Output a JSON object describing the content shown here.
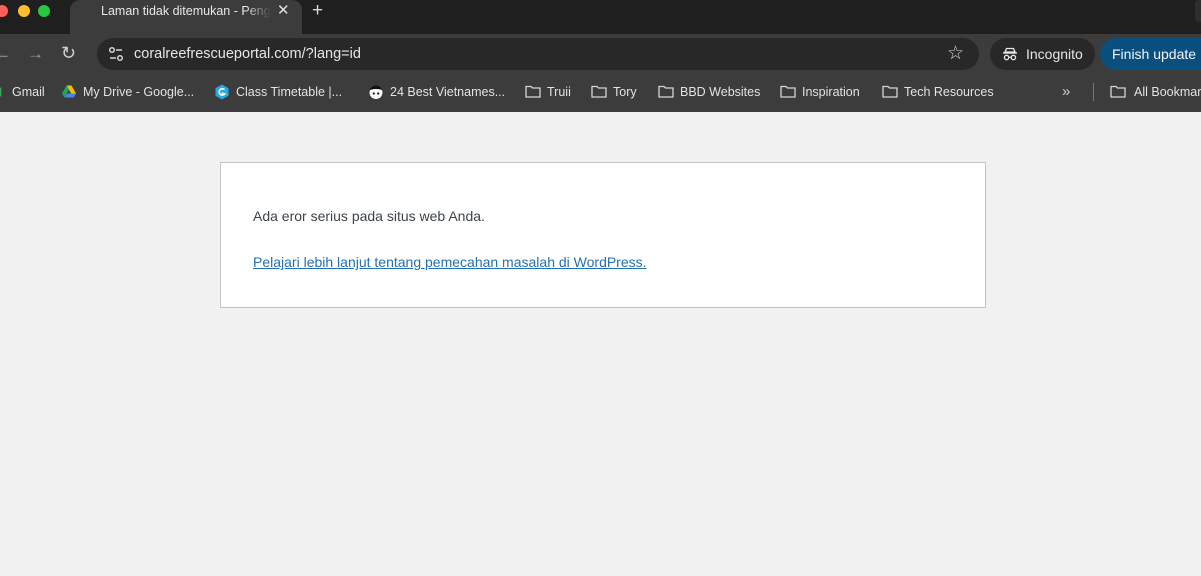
{
  "browser": {
    "tab": {
      "title": "Laman tidak ditemukan - Pengelola Situs"
    },
    "new_tab_symbol": "+",
    "tab_close_symbol": "✕",
    "address_bar": {
      "url": "coralreefrescueportal.com/?lang=id"
    },
    "incognito_label": "Incognito",
    "finish_update_label": "Finish update",
    "icons": {
      "back": "arrow-left-icon",
      "forward": "arrow-right-icon",
      "reload": "reload-icon",
      "site_info": "tune-icon",
      "bookmark_star": "star-icon",
      "incognito": "incognito-icon"
    }
  },
  "bookmarks": {
    "items": [
      {
        "label": "Gmail",
        "icon": "gmail-icon"
      },
      {
        "label": "My Drive - Google...",
        "icon": "google-drive-icon"
      },
      {
        "label": "Class Timetable |...",
        "icon": "hexagon-logo-icon"
      },
      {
        "label": "24 Best Vietnames...",
        "icon": "avatar-face-icon"
      },
      {
        "label": "Truii",
        "icon": "folder-icon"
      },
      {
        "label": "Tory",
        "icon": "folder-icon"
      },
      {
        "label": "BBD Websites",
        "icon": "folder-icon"
      },
      {
        "label": "Inspiration",
        "icon": "folder-icon"
      },
      {
        "label": "Tech Resources",
        "icon": "folder-icon"
      }
    ],
    "overflow_symbol": "»",
    "all_bookmarks_label": "All Bookmarks"
  },
  "page": {
    "error_message": "Ada eror serius pada situs web Anda.",
    "help_link": "Pelajari lebih lanjut tentang pemecahan masalah di WordPress."
  },
  "colors": {
    "tabstrip_bg": "#1f1f1f",
    "toolbar_bg": "#3c3c3c",
    "omnibox_bg": "#282828",
    "finish_update_bg": "#0b4f7e",
    "page_bg": "#f1f1f1",
    "link": "#2271b1"
  }
}
